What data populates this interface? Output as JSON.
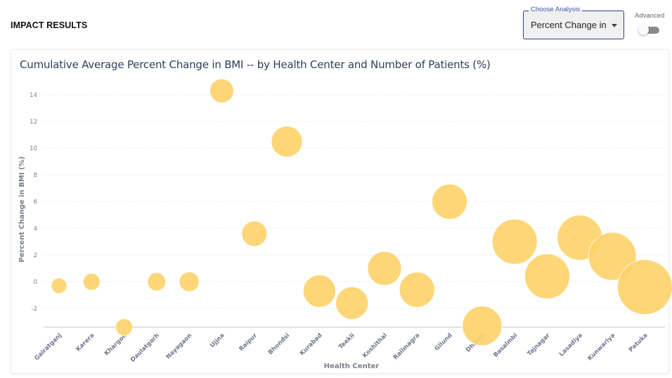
{
  "header": {
    "title": "IMPACT RESULTS",
    "analysis_select": {
      "label": "Choose Analysis",
      "value": "Percent Change in E"
    },
    "advanced_toggle": {
      "label": "Advanced",
      "checked": false
    }
  },
  "colors": {
    "bubble": "#fdd36b",
    "select_border": "#2a3d8f",
    "title_text": "#2f3e57"
  },
  "chart_data": {
    "type": "scatter",
    "subtype": "bubble",
    "title": "Cumulative Average Percent Change in BMI -- by Health Center and Number of Patients (%)",
    "xlabel": "Health Center",
    "ylabel": "Percent Change in BMI (%)",
    "ylim": [
      -3.4,
      15
    ],
    "yticks": [
      -2,
      0,
      2,
      4,
      6,
      8,
      10,
      12,
      14
    ],
    "grid": "horizontal-dotted",
    "legend": "none",
    "categories": [
      "Gairatganj",
      "Karera",
      "Khargon",
      "Daulatgarh",
      "Nayagaon",
      "Ujjna",
      "Raipur",
      "Bhondsi",
      "Kurabad",
      "Teekli",
      "Koshithal",
      "Railmagra",
      "Gilund",
      "Dhanla",
      "Basalmbi",
      "Tajnagar",
      "Lasadiya",
      "Kunwariya",
      "Patuka"
    ],
    "values": [
      -0.3,
      0.0,
      -3.4,
      0.0,
      0.0,
      14.3,
      3.6,
      10.5,
      -0.7,
      -1.6,
      1.0,
      -0.6,
      6.0,
      -3.3,
      3.0,
      0.4,
      3.3,
      1.9,
      -0.4
    ],
    "relative_size": [
      11,
      12,
      12,
      13,
      14,
      17,
      18,
      22,
      23,
      23,
      24,
      25,
      25,
      28,
      32,
      32,
      32,
      34,
      39
    ]
  }
}
